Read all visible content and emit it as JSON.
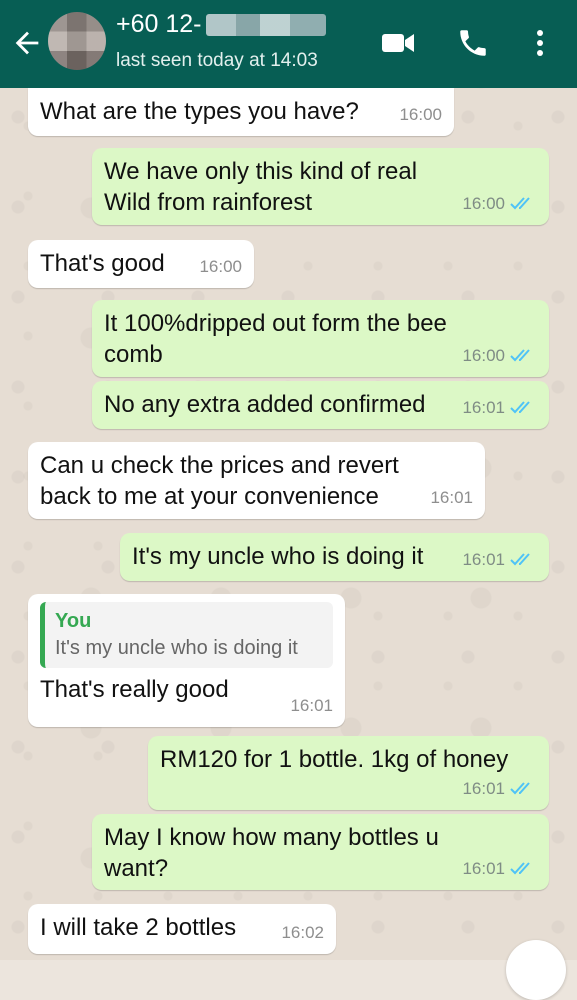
{
  "header": {
    "contact_name": "+60 12-",
    "status": "last seen today at 14:03",
    "icons": [
      "back-arrow-icon",
      "avatar",
      "video-call-icon",
      "phone-icon",
      "more-vert-icon"
    ],
    "color": "#075e54"
  },
  "messages": [
    {
      "direction": "in",
      "text": "What are the types you have?",
      "time": "16:00"
    },
    {
      "direction": "out",
      "text": "We have only this kind of real Wild from rainforest",
      "time": "16:00",
      "status": "read"
    },
    {
      "direction": "in",
      "text": "That's good",
      "time": "16:00"
    },
    {
      "direction": "out",
      "text": "It 100%dripped out form the bee comb",
      "time": "16:00",
      "status": "read"
    },
    {
      "direction": "out",
      "text": "No any extra added confirmed",
      "time": "16:01",
      "status": "read"
    },
    {
      "direction": "in",
      "text": "Can u check the prices and revert back to me at your convenience",
      "time": "16:01"
    },
    {
      "direction": "out",
      "text": "It's my uncle who is doing it",
      "time": "16:01",
      "status": "read"
    },
    {
      "direction": "in",
      "quote_author": "You",
      "quote_text": "It's my uncle who is doing it",
      "text": "That's really good",
      "time": "16:01"
    },
    {
      "direction": "out",
      "text": "RM120 for 1 bottle. 1kg of honey",
      "time": "16:01",
      "status": "read"
    },
    {
      "direction": "out",
      "text": "May I know how many bottles u want?",
      "time": "16:01",
      "status": "read"
    },
    {
      "direction": "in",
      "text": "I will take 2 bottles",
      "time": "16:02"
    }
  ],
  "colors": {
    "incoming": "#ffffff",
    "outgoing": "#dcf8c6",
    "read_tick": "#4fc3f7",
    "quote_accent": "#35a852"
  }
}
